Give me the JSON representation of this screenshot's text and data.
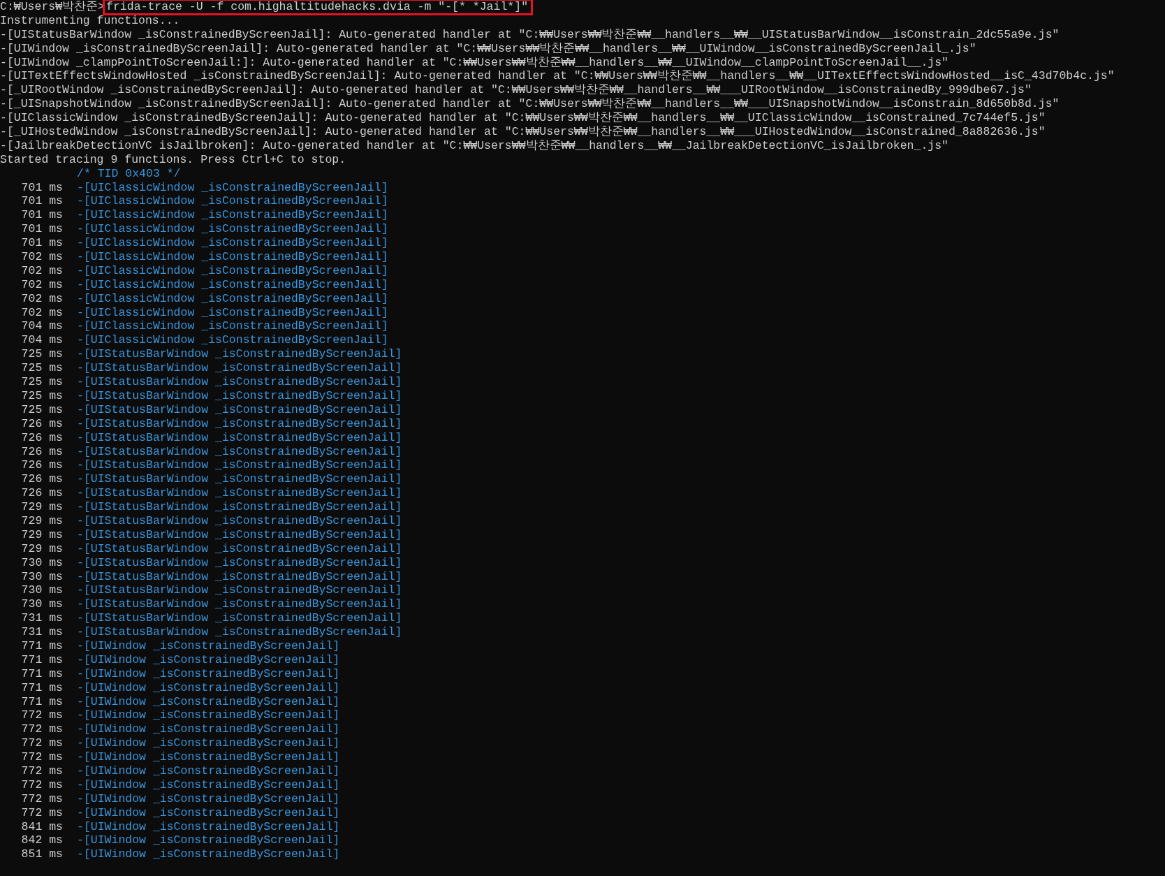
{
  "prompt": {
    "path": "C:₩Users₩박찬준>",
    "command": "frida-trace -U -f com.highaltitudehacks.dvia -m \"-[* *Jail*]\"",
    "highlighted": true
  },
  "output_lines": [
    "Instrumenting functions...",
    "-[UIStatusBarWindow _isConstrainedByScreenJail]: Auto-generated handler at \"C:₩₩Users₩₩박찬준₩₩__handlers__₩₩__UIStatusBarWindow__isConstrain_2dc55a9e.js\"",
    "-[UIWindow _isConstrainedByScreenJail]: Auto-generated handler at \"C:₩₩Users₩₩박찬준₩₩__handlers__₩₩__UIWindow__isConstrainedByScreenJail_.js\"",
    "-[UIWindow _clampPointToScreenJail:]: Auto-generated handler at \"C:₩₩Users₩₩박찬준₩₩__handlers__₩₩__UIWindow__clampPointToScreenJail__.js\"",
    "-[UITextEffectsWindowHosted _isConstrainedByScreenJail]: Auto-generated handler at \"C:₩₩Users₩₩박찬준₩₩__handlers__₩₩__UITextEffectsWindowHosted__isC_43d70b4c.js\"",
    "-[_UIRootWindow _isConstrainedByScreenJail]: Auto-generated handler at \"C:₩₩Users₩₩박찬준₩₩__handlers__₩₩___UIRootWindow__isConstrainedBy_999dbe67.js\"",
    "-[_UISnapshotWindow _isConstrainedByScreenJail]: Auto-generated handler at \"C:₩₩Users₩₩박찬준₩₩__handlers__₩₩___UISnapshotWindow__isConstrain_8d650b8d.js\"",
    "-[UIClassicWindow _isConstrainedByScreenJail]: Auto-generated handler at \"C:₩₩Users₩₩박찬준₩₩__handlers__₩₩__UIClassicWindow__isConstrained_7c744ef5.js\"",
    "-[_UIHostedWindow _isConstrainedByScreenJail]: Auto-generated handler at \"C:₩₩Users₩₩박찬준₩₩__handlers__₩₩___UIHostedWindow__isConstrained_8a882636.js\"",
    "-[JailbreakDetectionVC isJailbroken]: Auto-generated handler at \"C:₩₩Users₩₩박찬준₩₩__handlers__₩₩__JailbreakDetectionVC_isJailbroken_.js\"",
    "Started tracing 9 functions. Press Ctrl+C to stop."
  ],
  "trace": {
    "thread": "/* TID 0x403 */",
    "events": [
      {
        "time": "701 ms",
        "call": "-[UIClassicWindow _isConstrainedByScreenJail]"
      },
      {
        "time": "701 ms",
        "call": "-[UIClassicWindow _isConstrainedByScreenJail]"
      },
      {
        "time": "701 ms",
        "call": "-[UIClassicWindow _isConstrainedByScreenJail]"
      },
      {
        "time": "701 ms",
        "call": "-[UIClassicWindow _isConstrainedByScreenJail]"
      },
      {
        "time": "701 ms",
        "call": "-[UIClassicWindow _isConstrainedByScreenJail]"
      },
      {
        "time": "702 ms",
        "call": "-[UIClassicWindow _isConstrainedByScreenJail]"
      },
      {
        "time": "702 ms",
        "call": "-[UIClassicWindow _isConstrainedByScreenJail]"
      },
      {
        "time": "702 ms",
        "call": "-[UIClassicWindow _isConstrainedByScreenJail]"
      },
      {
        "time": "702 ms",
        "call": "-[UIClassicWindow _isConstrainedByScreenJail]"
      },
      {
        "time": "702 ms",
        "call": "-[UIClassicWindow _isConstrainedByScreenJail]"
      },
      {
        "time": "704 ms",
        "call": "-[UIClassicWindow _isConstrainedByScreenJail]"
      },
      {
        "time": "704 ms",
        "call": "-[UIClassicWindow _isConstrainedByScreenJail]"
      },
      {
        "time": "725 ms",
        "call": "-[UIStatusBarWindow _isConstrainedByScreenJail]"
      },
      {
        "time": "725 ms",
        "call": "-[UIStatusBarWindow _isConstrainedByScreenJail]"
      },
      {
        "time": "725 ms",
        "call": "-[UIStatusBarWindow _isConstrainedByScreenJail]"
      },
      {
        "time": "725 ms",
        "call": "-[UIStatusBarWindow _isConstrainedByScreenJail]"
      },
      {
        "time": "725 ms",
        "call": "-[UIStatusBarWindow _isConstrainedByScreenJail]"
      },
      {
        "time": "726 ms",
        "call": "-[UIStatusBarWindow _isConstrainedByScreenJail]"
      },
      {
        "time": "726 ms",
        "call": "-[UIStatusBarWindow _isConstrainedByScreenJail]"
      },
      {
        "time": "726 ms",
        "call": "-[UIStatusBarWindow _isConstrainedByScreenJail]"
      },
      {
        "time": "726 ms",
        "call": "-[UIStatusBarWindow _isConstrainedByScreenJail]"
      },
      {
        "time": "726 ms",
        "call": "-[UIStatusBarWindow _isConstrainedByScreenJail]"
      },
      {
        "time": "726 ms",
        "call": "-[UIStatusBarWindow _isConstrainedByScreenJail]"
      },
      {
        "time": "729 ms",
        "call": "-[UIStatusBarWindow _isConstrainedByScreenJail]"
      },
      {
        "time": "729 ms",
        "call": "-[UIStatusBarWindow _isConstrainedByScreenJail]"
      },
      {
        "time": "729 ms",
        "call": "-[UIStatusBarWindow _isConstrainedByScreenJail]"
      },
      {
        "time": "729 ms",
        "call": "-[UIStatusBarWindow _isConstrainedByScreenJail]"
      },
      {
        "time": "730 ms",
        "call": "-[UIStatusBarWindow _isConstrainedByScreenJail]"
      },
      {
        "time": "730 ms",
        "call": "-[UIStatusBarWindow _isConstrainedByScreenJail]"
      },
      {
        "time": "730 ms",
        "call": "-[UIStatusBarWindow _isConstrainedByScreenJail]"
      },
      {
        "time": "730 ms",
        "call": "-[UIStatusBarWindow _isConstrainedByScreenJail]"
      },
      {
        "time": "731 ms",
        "call": "-[UIStatusBarWindow _isConstrainedByScreenJail]"
      },
      {
        "time": "731 ms",
        "call": "-[UIStatusBarWindow _isConstrainedByScreenJail]"
      },
      {
        "time": "771 ms",
        "call": "-[UIWindow _isConstrainedByScreenJail]"
      },
      {
        "time": "771 ms",
        "call": "-[UIWindow _isConstrainedByScreenJail]"
      },
      {
        "time": "771 ms",
        "call": "-[UIWindow _isConstrainedByScreenJail]"
      },
      {
        "time": "771 ms",
        "call": "-[UIWindow _isConstrainedByScreenJail]"
      },
      {
        "time": "771 ms",
        "call": "-[UIWindow _isConstrainedByScreenJail]"
      },
      {
        "time": "772 ms",
        "call": "-[UIWindow _isConstrainedByScreenJail]"
      },
      {
        "time": "772 ms",
        "call": "-[UIWindow _isConstrainedByScreenJail]"
      },
      {
        "time": "772 ms",
        "call": "-[UIWindow _isConstrainedByScreenJail]"
      },
      {
        "time": "772 ms",
        "call": "-[UIWindow _isConstrainedByScreenJail]"
      },
      {
        "time": "772 ms",
        "call": "-[UIWindow _isConstrainedByScreenJail]"
      },
      {
        "time": "772 ms",
        "call": "-[UIWindow _isConstrainedByScreenJail]"
      },
      {
        "time": "772 ms",
        "call": "-[UIWindow _isConstrainedByScreenJail]"
      },
      {
        "time": "772 ms",
        "call": "-[UIWindow _isConstrainedByScreenJail]"
      },
      {
        "time": "841 ms",
        "call": "-[UIWindow _isConstrainedByScreenJail]"
      },
      {
        "time": "842 ms",
        "call": "-[UIWindow _isConstrainedByScreenJail]"
      },
      {
        "time": "851 ms",
        "call": "-[UIWindow _isConstrainedByScreenJail]"
      }
    ]
  }
}
